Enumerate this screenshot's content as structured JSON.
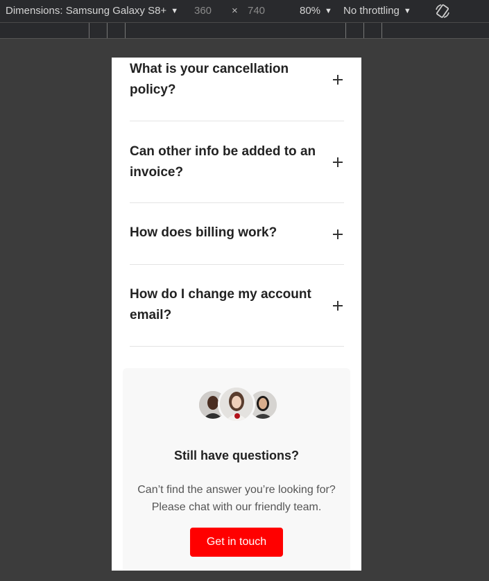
{
  "toolbar": {
    "dimensions_label": "Dimensions: Samsung Galaxy S8+",
    "width": "360",
    "times": "×",
    "height": "740",
    "zoom": "80%",
    "throttling": "No throttling",
    "rotate_icon": "rotate-icon"
  },
  "faq": {
    "items": [
      {
        "question": "What is your cancellation policy?"
      },
      {
        "question": "Can other info be added to an invoice?"
      },
      {
        "question": "How does billing work?"
      },
      {
        "question": "How do I change my account email?"
      }
    ]
  },
  "cta": {
    "title": "Still have questions?",
    "text": "Can’t find the answer you’re looking for? Please chat with our friendly team.",
    "button_label": "Get in touch",
    "accent_color": "#ff0000"
  }
}
